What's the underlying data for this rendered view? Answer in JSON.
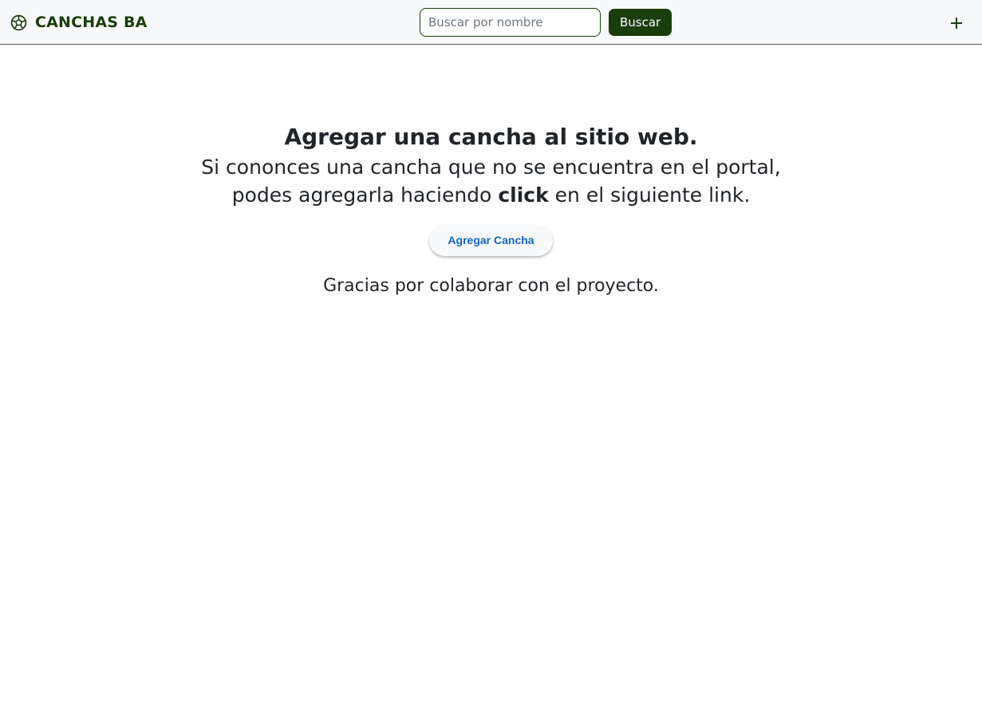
{
  "navbar": {
    "brand_text": "CANCHAS BA",
    "brand_icon": "soccer-ball-icon",
    "search": {
      "placeholder": "Buscar por nombre",
      "value": "",
      "button_label": "Buscar"
    },
    "add_icon": "plus-icon"
  },
  "main": {
    "title": "Agregar una cancha al sitio web.",
    "subtitle_line1": "Si cononces una cancha que no se encuentra en el portal,",
    "subtitle_line2_before": "podes agregarla haciendo",
    "subtitle_line2_bold": "click",
    "subtitle_line2_after": "en el siguiente link.",
    "add_button_label": "Agregar Cancha",
    "thanks": "Gracias por colaborar con el proyecto."
  },
  "colors": {
    "brand_green": "#1a3d0c",
    "navbar_bg": "#f8f9fa",
    "link_blue": "#1565c0"
  }
}
